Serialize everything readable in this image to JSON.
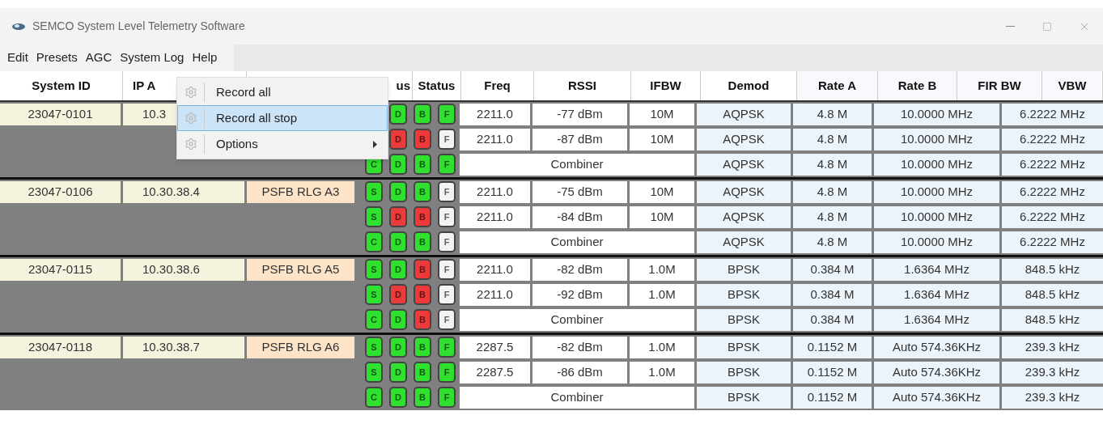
{
  "window": {
    "title": "SEMCO System Level Telemetry Software"
  },
  "menu_bar": [
    {
      "label": "Edit"
    },
    {
      "label": "Presets"
    },
    {
      "label": "AGC"
    },
    {
      "label": "System Log"
    },
    {
      "label": "Help"
    }
  ],
  "open_menu": {
    "items": [
      {
        "label": "Record all",
        "selected": false,
        "submenu": false
      },
      {
        "label": "Record all stop",
        "selected": true,
        "submenu": false
      },
      {
        "label": "Options",
        "selected": false,
        "submenu": true
      }
    ]
  },
  "table": {
    "columns": [
      "System ID",
      "IP A",
      "us",
      "Status",
      "Freq",
      "RSSI",
      "IFBW",
      "Demod",
      "Rate A",
      "Rate B",
      "FIR BW",
      "VBW"
    ],
    "groups": [
      {
        "system_id": "23047-0101",
        "ip": "10.3",
        "rows": [
          {
            "kind": "channel",
            "lamps": [
              {
                "label": "D",
                "color": "#2fe02f"
              },
              {
                "label": "B",
                "color": "#2fe02f"
              },
              {
                "label": "F",
                "color": "#2fe02f"
              }
            ],
            "freq": "2211.0",
            "rssi": "-77 dBm",
            "ifbw": "10M",
            "demod": "AQPSK",
            "rate_a": "4.8 M",
            "bw_a": "10.0000 MHz",
            "bw_b": "6.2222 MHz"
          },
          {
            "kind": "channel",
            "lamps": [
              {
                "label": "D",
                "color": "#ec3a3a"
              },
              {
                "label": "B",
                "color": "#ec3a3a"
              },
              {
                "label": "F",
                "color": "#f2f2f2"
              }
            ],
            "freq": "2211.0",
            "rssi": "-87 dBm",
            "ifbw": "10M",
            "demod": "AQPSK",
            "rate_a": "4.8 M",
            "bw_a": "10.0000 MHz",
            "bw_b": "6.2222 MHz"
          },
          {
            "kind": "combiner",
            "lamps": [
              {
                "label": "C",
                "color": "#2fe02f"
              },
              {
                "label": "D",
                "color": "#2fe02f"
              },
              {
                "label": "B",
                "color": "#2fe02f"
              },
              {
                "label": "F",
                "color": "#2fe02f"
              }
            ],
            "label": "Combiner",
            "demod": "AQPSK",
            "rate_a": "4.8 M",
            "bw_a": "10.0000 MHz",
            "bw_b": "6.2222 MHz"
          }
        ]
      },
      {
        "system_id": "23047-0106",
        "ip": "10.30.38.4",
        "name": "PSFB RLG A3",
        "rows": [
          {
            "kind": "channel",
            "lamps": [
              {
                "label": "S",
                "color": "#2fe02f"
              },
              {
                "label": "D",
                "color": "#2fe02f"
              },
              {
                "label": "B",
                "color": "#2fe02f"
              },
              {
                "label": "F",
                "color": "#f2f2f2"
              }
            ],
            "freq": "2211.0",
            "rssi": "-75 dBm",
            "ifbw": "10M",
            "demod": "AQPSK",
            "rate_a": "4.8 M",
            "bw_a": "10.0000 MHz",
            "bw_b": "6.2222 MHz"
          },
          {
            "kind": "channel",
            "lamps": [
              {
                "label": "S",
                "color": "#2fe02f"
              },
              {
                "label": "D",
                "color": "#ec3a3a"
              },
              {
                "label": "B",
                "color": "#ec3a3a"
              },
              {
                "label": "F",
                "color": "#f2f2f2"
              }
            ],
            "freq": "2211.0",
            "rssi": "-84 dBm",
            "ifbw": "10M",
            "demod": "AQPSK",
            "rate_a": "4.8 M",
            "bw_a": "10.0000 MHz",
            "bw_b": "6.2222 MHz"
          },
          {
            "kind": "combiner",
            "lamps": [
              {
                "label": "C",
                "color": "#2fe02f"
              },
              {
                "label": "D",
                "color": "#2fe02f"
              },
              {
                "label": "B",
                "color": "#2fe02f"
              },
              {
                "label": "F",
                "color": "#f2f2f2"
              }
            ],
            "label": "Combiner",
            "demod": "AQPSK",
            "rate_a": "4.8 M",
            "bw_a": "10.0000 MHz",
            "bw_b": "6.2222 MHz"
          }
        ]
      },
      {
        "system_id": "23047-0115",
        "ip": "10.30.38.6",
        "name": "PSFB RLG A5",
        "rows": [
          {
            "kind": "channel",
            "lamps": [
              {
                "label": "S",
                "color": "#2fe02f"
              },
              {
                "label": "D",
                "color": "#2fe02f"
              },
              {
                "label": "B",
                "color": "#ec3a3a"
              },
              {
                "label": "F",
                "color": "#f2f2f2"
              }
            ],
            "freq": "2211.0",
            "rssi": "-82 dBm",
            "ifbw": "1.0M",
            "demod": "BPSK",
            "rate_a": "0.384 M",
            "bw_a": "1.6364 MHz",
            "bw_b": "848.5 kHz"
          },
          {
            "kind": "channel",
            "lamps": [
              {
                "label": "S",
                "color": "#2fe02f"
              },
              {
                "label": "D",
                "color": "#ec3a3a"
              },
              {
                "label": "B",
                "color": "#ec3a3a"
              },
              {
                "label": "F",
                "color": "#f2f2f2"
              }
            ],
            "freq": "2211.0",
            "rssi": "-92 dBm",
            "ifbw": "1.0M",
            "demod": "BPSK",
            "rate_a": "0.384 M",
            "bw_a": "1.6364 MHz",
            "bw_b": "848.5 kHz"
          },
          {
            "kind": "combiner",
            "lamps": [
              {
                "label": "C",
                "color": "#2fe02f"
              },
              {
                "label": "D",
                "color": "#2fe02f"
              },
              {
                "label": "B",
                "color": "#ec3a3a"
              },
              {
                "label": "F",
                "color": "#f2f2f2"
              }
            ],
            "label": "Combiner",
            "demod": "BPSK",
            "rate_a": "0.384 M",
            "bw_a": "1.6364 MHz",
            "bw_b": "848.5 kHz"
          }
        ]
      },
      {
        "system_id": "23047-0118",
        "ip": "10.30.38.7",
        "name": "PSFB RLG A6",
        "rows": [
          {
            "kind": "channel",
            "lamps": [
              {
                "label": "S",
                "color": "#2fe02f"
              },
              {
                "label": "D",
                "color": "#2fe02f"
              },
              {
                "label": "B",
                "color": "#2fe02f"
              },
              {
                "label": "F",
                "color": "#2fe02f"
              }
            ],
            "freq": "2287.5",
            "rssi": "-82 dBm",
            "ifbw": "1.0M",
            "demod": "BPSK",
            "rate_a": "0.1152 M",
            "bw_a": "Auto 574.36KHz",
            "bw_b": "239.3 kHz"
          },
          {
            "kind": "channel",
            "lamps": [
              {
                "label": "S",
                "color": "#2fe02f"
              },
              {
                "label": "D",
                "color": "#2fe02f"
              },
              {
                "label": "B",
                "color": "#2fe02f"
              },
              {
                "label": "F",
                "color": "#2fe02f"
              }
            ],
            "freq": "2287.5",
            "rssi": "-86 dBm",
            "ifbw": "1.0M",
            "demod": "BPSK",
            "rate_a": "0.1152 M",
            "bw_a": "Auto 574.36KHz",
            "bw_b": "239.3 kHz"
          },
          {
            "kind": "combiner",
            "lamps": [
              {
                "label": "C",
                "color": "#2fe02f"
              },
              {
                "label": "D",
                "color": "#2fe02f"
              },
              {
                "label": "B",
                "color": "#2fe02f"
              },
              {
                "label": "F",
                "color": "#2fe02f"
              }
            ],
            "label": "Combiner",
            "demod": "BPSK",
            "rate_a": "0.1152 M",
            "bw_a": "Auto 574.36KHz",
            "bw_b": "239.3 kHz"
          }
        ]
      }
    ]
  }
}
